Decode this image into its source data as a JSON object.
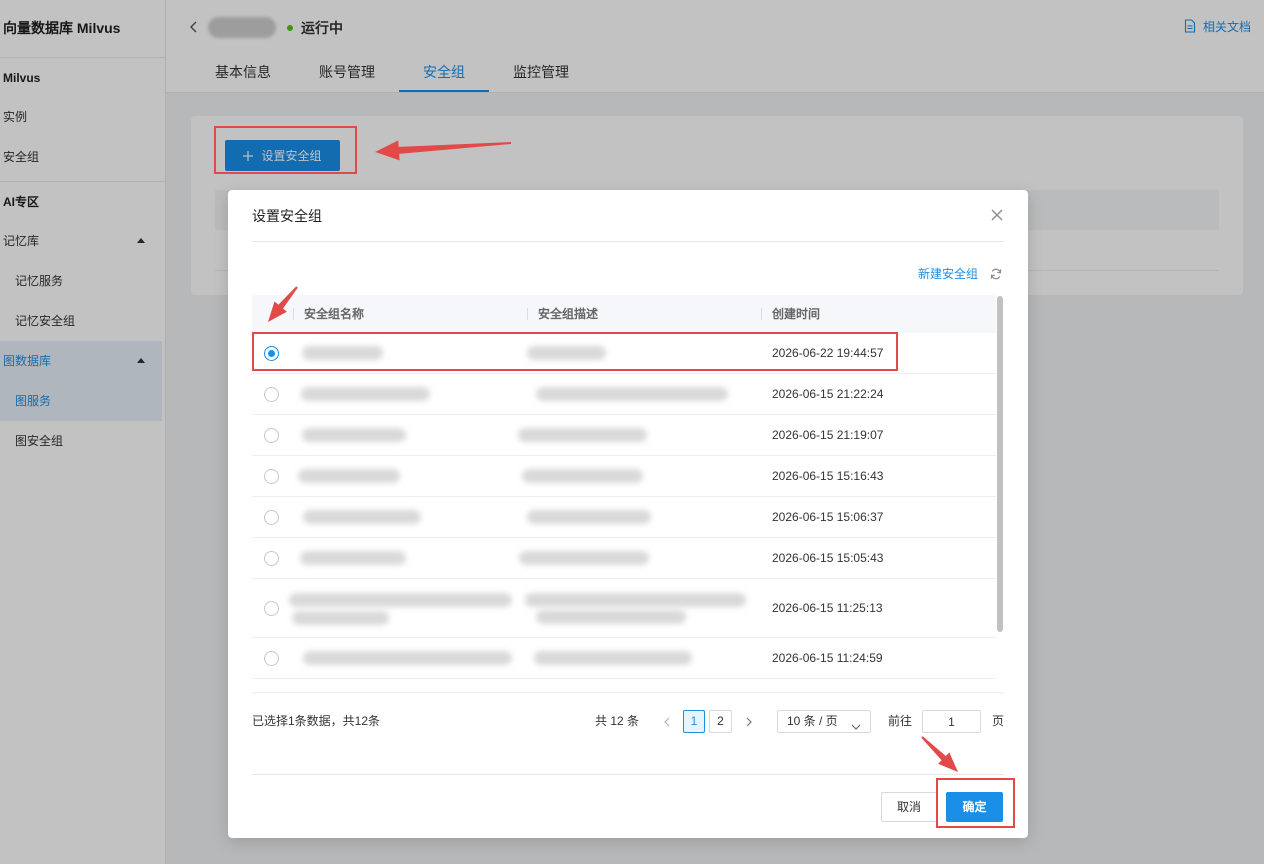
{
  "sidebar": {
    "title": "向量数据库 Milvus",
    "milvus": {
      "header": "Milvus",
      "items": [
        {
          "label": "实例"
        },
        {
          "label": "安全组"
        }
      ]
    },
    "ai": {
      "header": "AI专区",
      "groups": [
        {
          "label": "记忆库",
          "expanded": true,
          "active": false,
          "items": [
            {
              "label": "记忆服务"
            },
            {
              "label": "记忆安全组"
            }
          ]
        },
        {
          "label": "图数据库",
          "expanded": true,
          "active": true,
          "items": [
            {
              "label": "图服务",
              "active": true
            },
            {
              "label": "图安全组",
              "active": false
            }
          ]
        }
      ]
    }
  },
  "header": {
    "status": "运行中",
    "docs_link": "相关文档",
    "tabs": [
      {
        "label": "基本信息",
        "active": false
      },
      {
        "label": "账号管理",
        "active": false
      },
      {
        "label": "安全组",
        "active": true
      },
      {
        "label": "监控管理",
        "active": false
      }
    ]
  },
  "main": {
    "set_security_group_button": "设置安全组"
  },
  "modal": {
    "title": "设置安全组",
    "create_link": "新建安全组",
    "columns": [
      "安全组名称",
      "安全组描述",
      "创建时间"
    ],
    "rows": [
      {
        "created": "2026-06-22 19:44:57",
        "selected": true
      },
      {
        "created": "2026-06-15 21:22:24",
        "selected": false
      },
      {
        "created": "2026-06-15 21:19:07",
        "selected": false
      },
      {
        "created": "2026-06-15 15:16:43",
        "selected": false
      },
      {
        "created": "2026-06-15 15:06:37",
        "selected": false
      },
      {
        "created": "2026-06-15 15:05:43",
        "selected": false
      },
      {
        "created": "2026-06-15 11:25:13",
        "selected": false
      },
      {
        "created": "2026-06-15 11:24:59",
        "selected": false
      }
    ],
    "selection_summary": "已选择1条数据，共12条",
    "pagination": {
      "total": "共 12 条",
      "pages": [
        {
          "label": "1",
          "active": true
        },
        {
          "label": "2",
          "active": false
        }
      ],
      "page_size": "10 条 / 页",
      "goto_label": "前往",
      "goto_value": "1",
      "goto_suffix": "页"
    },
    "cancel": "取消",
    "confirm": "确定"
  },
  "icons": {
    "back": "chevron-left-icon",
    "docs": "document-icon",
    "add": "plus-icon",
    "close": "close-icon",
    "refresh": "refresh-icon",
    "prev_page": "chevron-left-icon",
    "next_page": "chevron-right-icon",
    "page_size": "chevron-down-icon",
    "group_toggle": "caret-up-icon"
  },
  "colors": {
    "primary": "#1a8fe8",
    "status_running": "#52c41a",
    "annotation": "#e24a4a"
  }
}
